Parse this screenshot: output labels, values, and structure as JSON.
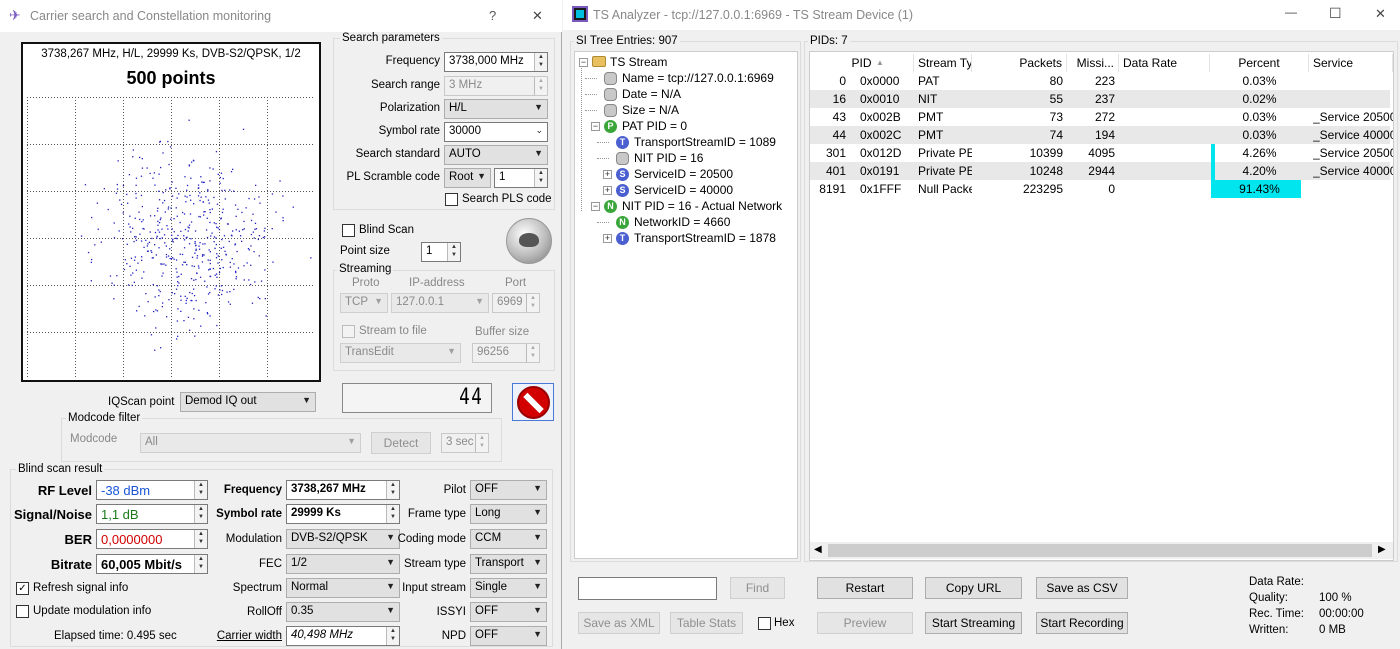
{
  "left_window": {
    "title": "Carrier search and Constellation monitoring",
    "help_btn": "?",
    "close_btn": "✕",
    "plot": {
      "header": "3738,267 MHz, H/L, 29999 Ks, DVB-S2/QPSK, 1/2",
      "points_label": "500 points"
    },
    "search_params": {
      "title": "Search parameters",
      "frequency_label": "Frequency",
      "frequency_value": "3738,000 MHz",
      "search_range_label": "Search range",
      "search_range_value": "3 MHz",
      "polarization_label": "Polarization",
      "polarization_value": "H/L",
      "symbol_rate_label": "Symbol rate",
      "symbol_rate_value": "30000",
      "search_standard_label": "Search standard",
      "search_standard_value": "AUTO",
      "pl_scramble_label": "PL Scramble code",
      "pl_scramble_value": "Root",
      "pl_scramble_num": "1",
      "search_pls_label": "Search PLS code"
    },
    "blind_scan_label": "Blind Scan",
    "point_size_label": "Point size",
    "point_size_value": "1",
    "streaming": {
      "title": "Streaming",
      "proto_label": "Proto",
      "ip_label": "IP-address",
      "port_label": "Port",
      "proto_value": "TCP",
      "ip_value": "127.0.0.1",
      "port_value": "6969",
      "stream_to_file_label": "Stream to file",
      "buffer_size_label": "Buffer size",
      "file_value": "TransEdit",
      "buffer_value": "96256"
    },
    "counter": "44",
    "iqscan_label": "IQScan point",
    "iqscan_value": "Demod IQ out",
    "modcode_filter": {
      "title": "Modcode filter",
      "modcode_label": "Modcode",
      "modcode_value": "All",
      "detect_btn": "Detect",
      "timeout_value": "3 sec"
    },
    "result": {
      "title": "Blind scan result",
      "rf_level_label": "RF Level",
      "rf_level_value": "-38 dBm",
      "snr_label": "Signal/Noise",
      "snr_value": "1,1 dB",
      "ber_label": "BER",
      "ber_value": "0,0000000",
      "bitrate_label": "Bitrate",
      "bitrate_value": "60,005 Mbit/s",
      "frequency_label": "Frequency",
      "frequency_value": "3738,267 MHz",
      "symbol_rate_label": "Symbol rate",
      "symbol_rate_value": "29999 Ks",
      "modulation_label": "Modulation",
      "modulation_value": "DVB-S2/QPSK",
      "fec_label": "FEC",
      "fec_value": "1/2",
      "spectrum_label": "Spectrum",
      "spectrum_value": "Normal",
      "rolloff_label": "RollOff",
      "rolloff_value": "0.35",
      "carrier_width_label": "Carrier width",
      "carrier_width_value": "40,498 MHz",
      "pilot_label": "Pilot",
      "pilot_value": "OFF",
      "frame_type_label": "Frame type",
      "frame_type_value": "Long",
      "coding_mode_label": "Coding mode",
      "coding_mode_value": "CCM",
      "stream_type_label": "Stream type",
      "stream_type_value": "Transport",
      "input_stream_label": "Input stream",
      "input_stream_value": "Single",
      "issyi_label": "ISSYI",
      "issyi_value": "OFF",
      "npd_label": "NPD",
      "npd_value": "OFF"
    },
    "refresh_label": "Refresh signal info",
    "update_mod_label": "Update modulation info",
    "elapsed": "Elapsed time: 0.495 sec"
  },
  "right_window": {
    "title": "TS Analyzer - tcp://127.0.0.1:6969 - TS Stream Device (1)",
    "min_btn": "—",
    "max_btn": "☐",
    "close_btn": "✕",
    "si_tree_title": "SI Tree Entries: 907",
    "pids_title": "PIDs: 7",
    "tree": [
      "TS Stream",
      "Name = tcp://127.0.0.1:6969",
      "Date = N/A",
      "Size = N/A",
      "PAT PID = 0",
      "TransportStreamID = 1089",
      "NIT PID = 16",
      "ServiceID = 20500",
      "ServiceID = 40000",
      "NIT PID = 16 - Actual Network",
      "NetworkID = 4660",
      "TransportStreamID = 1878"
    ],
    "columns": [
      "PID",
      "Stream Type",
      "Packets",
      "Missi...",
      "Data Rate",
      "Percent",
      "Service"
    ],
    "rows": [
      {
        "pid": "0",
        "hex": "0x0000",
        "type": "PAT",
        "packets": "80",
        "missing": "223",
        "rate": "",
        "percent": "0.03%",
        "service": ""
      },
      {
        "pid": "16",
        "hex": "0x0010",
        "type": "NIT",
        "packets": "55",
        "missing": "237",
        "rate": "",
        "percent": "0.02%",
        "service": ""
      },
      {
        "pid": "43",
        "hex": "0x002B",
        "type": "PMT",
        "packets": "73",
        "missing": "272",
        "rate": "",
        "percent": "0.03%",
        "service": "_Service 20500"
      },
      {
        "pid": "44",
        "hex": "0x002C",
        "type": "PMT",
        "packets": "74",
        "missing": "194",
        "rate": "",
        "percent": "0.03%",
        "service": "_Service 40000"
      },
      {
        "pid": "301",
        "hex": "0x012D",
        "type": "Private PES",
        "packets": "10399",
        "missing": "4095",
        "rate": "",
        "percent": "4.26%",
        "service": "_Service 20500"
      },
      {
        "pid": "401",
        "hex": "0x0191",
        "type": "Private PES",
        "packets": "10248",
        "missing": "2944",
        "rate": "",
        "percent": "4.20%",
        "service": "_Service 40000"
      },
      {
        "pid": "8191",
        "hex": "0x1FFF",
        "type": "Null Packets",
        "packets": "223295",
        "missing": "0",
        "rate": "",
        "percent": "91.43%",
        "service": ""
      }
    ],
    "percent_fractions": [
      0.0003,
      0.0002,
      0.0003,
      0.0003,
      0.0426,
      0.042,
      0.9143
    ],
    "find_placeholder": "",
    "find_btn": "Find",
    "save_xml_btn": "Save as XML",
    "table_stats_btn": "Table Stats",
    "hex_label": "Hex",
    "restart_btn": "Restart",
    "copy_url_btn": "Copy URL",
    "save_csv_btn": "Save as CSV",
    "preview_btn": "Preview",
    "start_streaming_btn": "Start Streaming",
    "start_recording_btn": "Start Recording",
    "stats": {
      "data_rate_label": "Data Rate:",
      "quality_label": "Quality:",
      "quality_value": "100 %",
      "rec_time_label": "Rec. Time:",
      "rec_time_value": "00:00:00",
      "written_label": "Written:",
      "written_value": "0 MB"
    }
  },
  "colors": {
    "rf_blue": "#1a56d6",
    "snr_green": "#1a7a1a",
    "ber_red": "#d00000",
    "percent_cyan": "#00e5ee",
    "dot_blue": "#2020c0"
  }
}
